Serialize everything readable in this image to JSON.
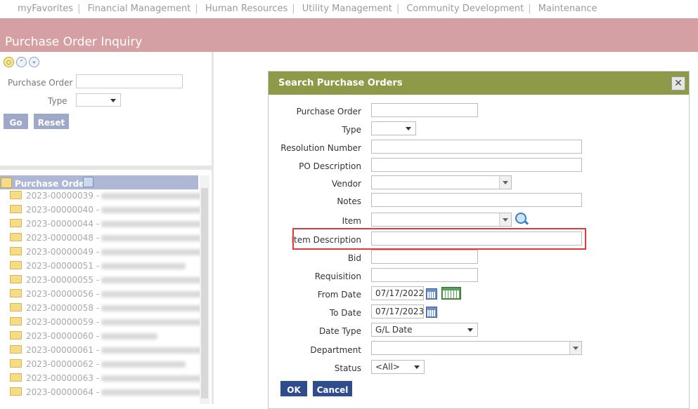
{
  "topnav": {
    "items": [
      "myFavorites",
      "Financial Management",
      "Human Resources",
      "Utility Management",
      "Community Development",
      "Maintenance"
    ]
  },
  "page": {
    "title": "Purchase Order Inquiry"
  },
  "left": {
    "po_label": "Purchase Order",
    "type_label": "Type",
    "go": "Go",
    "reset": "Reset",
    "tree_title": "Purchase Orders",
    "rows": [
      "2023-00000039 -",
      "2023-00000040 -",
      "2023-00000044 -",
      "2023-00000048 -",
      "2023-00000049 -",
      "2023-00000051 -",
      "2023-00000055 -",
      "2023-00000056 -",
      "2023-00000058 -",
      "2023-00000059 -",
      "2023-00000060 -",
      "2023-00000061 -",
      "2023-00000062 -",
      "2023-00000063 -",
      "2023-00000064 -"
    ]
  },
  "dialog": {
    "title": "Search Purchase Orders",
    "close": "✕",
    "labels": {
      "po": "Purchase Order",
      "type": "Type",
      "resolution": "Resolution Number",
      "po_desc": "PO Description",
      "vendor": "Vendor",
      "notes": "Notes",
      "item": "Item",
      "item_desc": "Item Description",
      "bid": "Bid",
      "requisition": "Requisition",
      "from_date": "From Date",
      "to_date": "To Date",
      "date_type": "Date Type",
      "department": "Department",
      "status": "Status"
    },
    "values": {
      "from_date": "07/17/2022",
      "to_date": "07/17/2023",
      "date_type": "G/L Date",
      "status": "<All>"
    },
    "ok": "OK",
    "cancel": "Cancel"
  },
  "colors": {
    "title_bar": "#d4a0a3",
    "dialog_header": "#8e9a47",
    "highlight": "#e23a3a",
    "primary_button": "#2f4d8d"
  }
}
